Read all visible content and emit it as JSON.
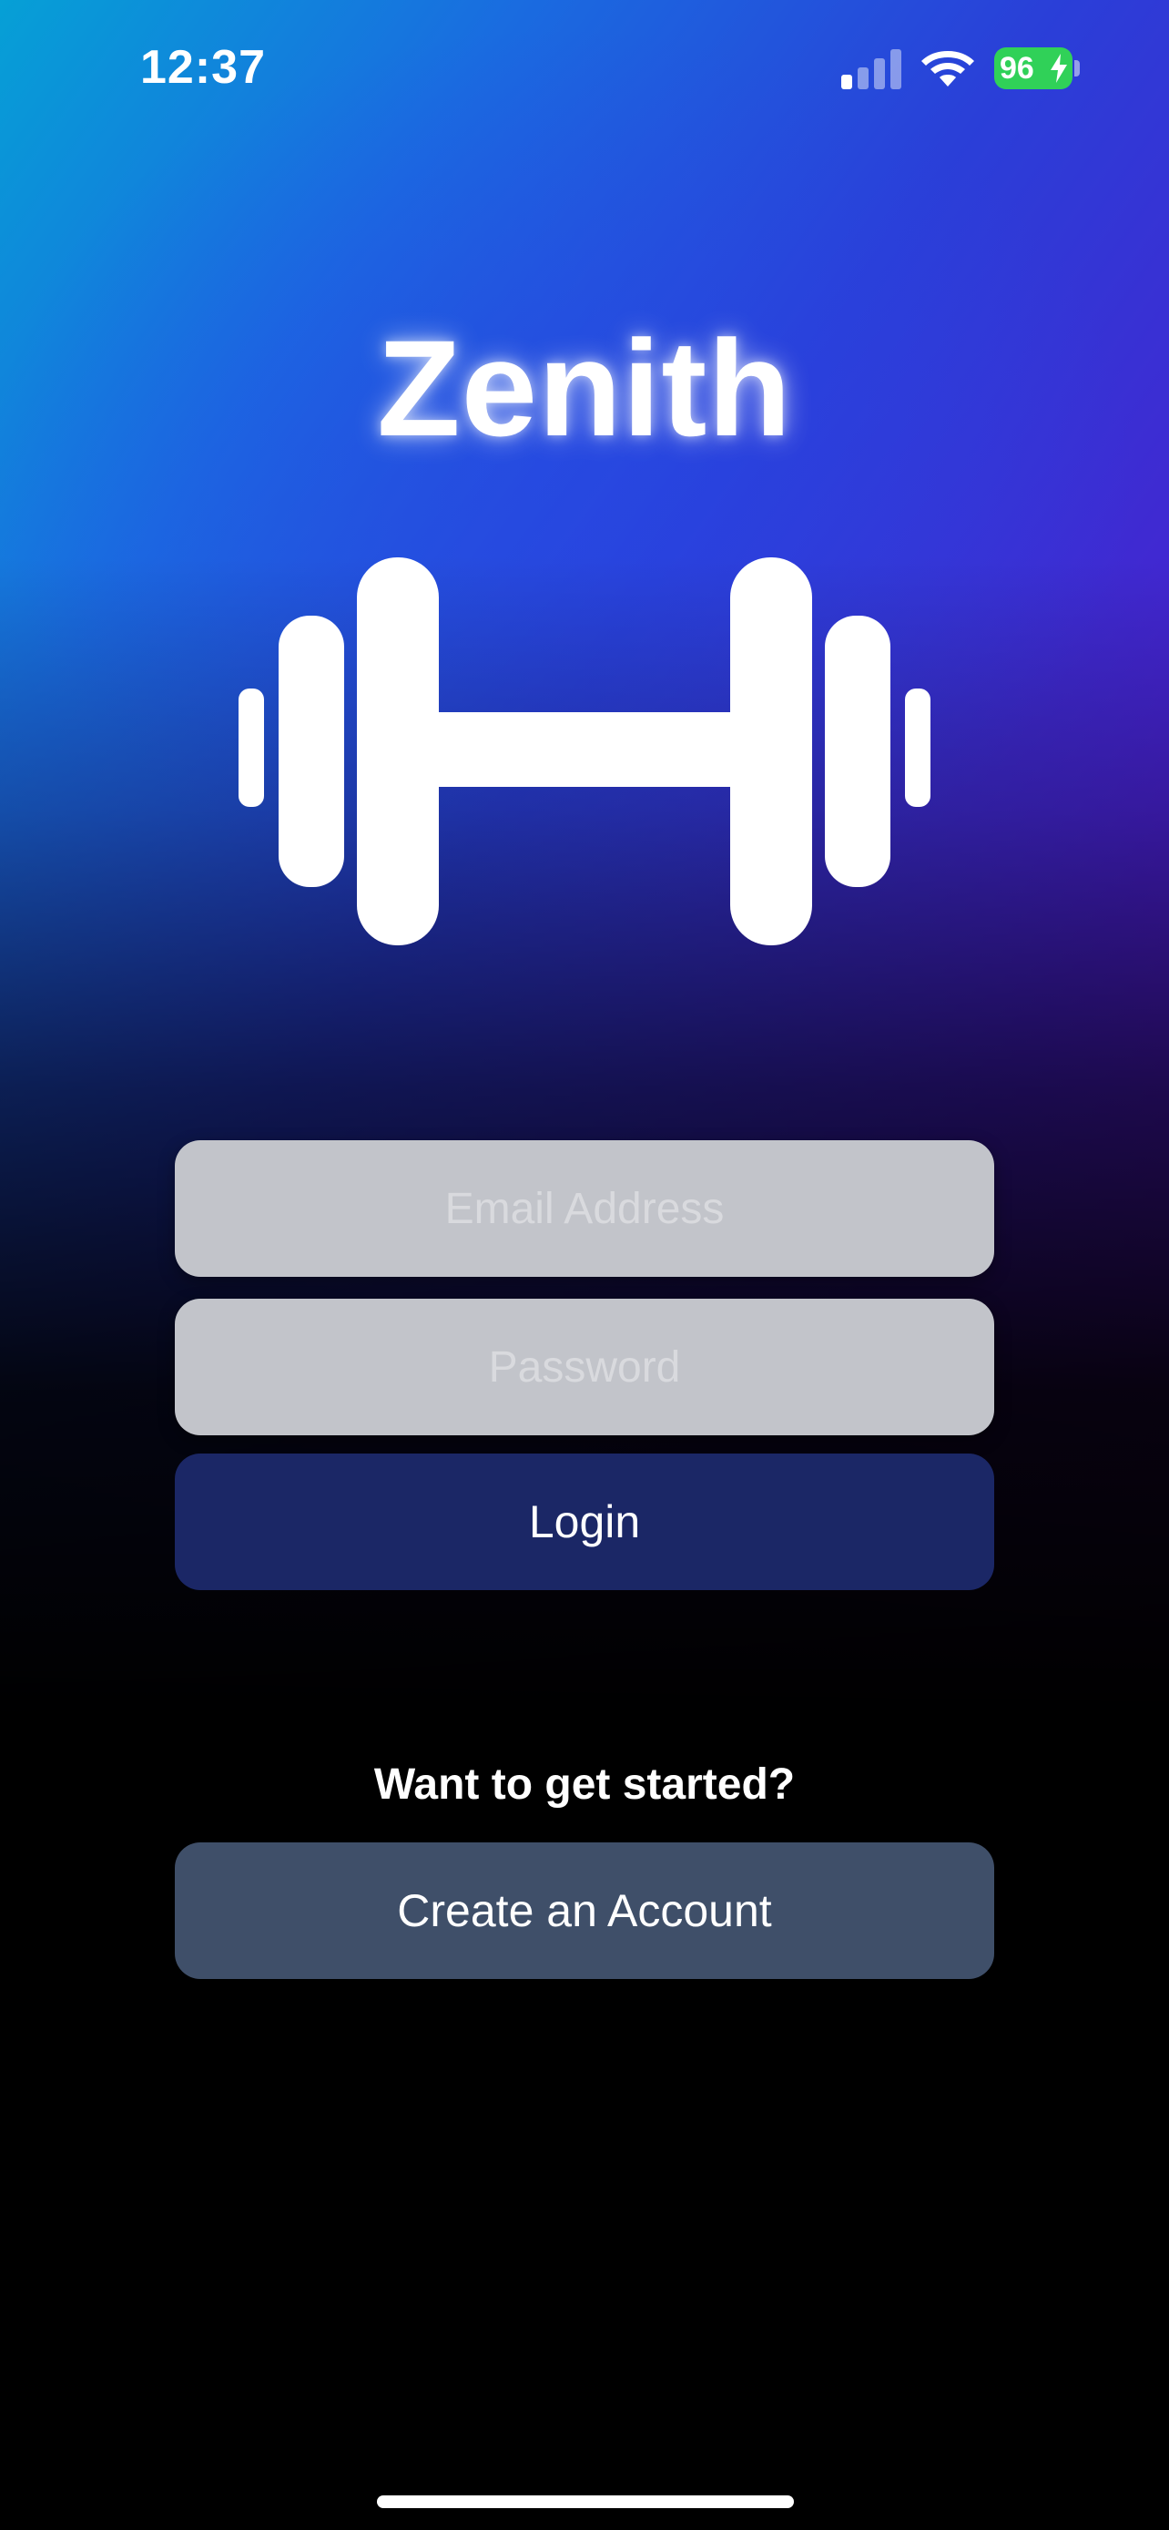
{
  "status_bar": {
    "time": "12:37",
    "battery": "96",
    "signal_bars_active": 1,
    "signal_bars_total": 4,
    "battery_color": "#30d158"
  },
  "app": {
    "title": "Zenith",
    "logo_icon": "dumbbell-icon"
  },
  "login_form": {
    "email_placeholder": "Email Address",
    "email_value": "",
    "password_placeholder": "Password",
    "password_value": "",
    "login_label": "Login"
  },
  "signup": {
    "prompt": "Want to get started?",
    "create_account_label": "Create an Account"
  },
  "colors": {
    "login_button": "#1b2766",
    "create_button": "#3f4f69",
    "field_background": "#c2c4ca",
    "gradient_start": "#06a0d6",
    "gradient_mid": "#2a3fd8",
    "gradient_end": "#6a12c8"
  }
}
